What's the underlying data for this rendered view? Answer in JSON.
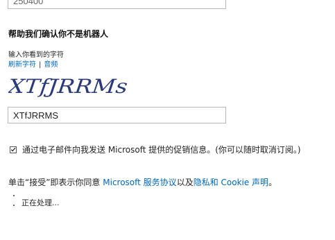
{
  "previous_field": {
    "value": "250400"
  },
  "captcha": {
    "heading": "帮助我们确认你不是机器人",
    "instruction": "输入你看到的字符",
    "refresh_link": "刷新字符",
    "separator": "|",
    "audio_link": "音频",
    "image_text": "XTfJRRMs",
    "input_value": "XTfJRRMS"
  },
  "promo": {
    "checked": true,
    "text": "通过电子邮件向我发送 Microsoft 提供的促销信息。(你可以随时取消订阅。)"
  },
  "terms": {
    "prefix": "单击“接受”即表示你同意 ",
    "services_link": "Microsoft 服务协议",
    "middle": "以及",
    "privacy_link": "隐私和 Cookie 声明",
    "suffix": "。"
  },
  "status": {
    "text": "正在处理..."
  },
  "colors": {
    "link": "#0067b8",
    "captcha_ink": "#2a3a78"
  }
}
